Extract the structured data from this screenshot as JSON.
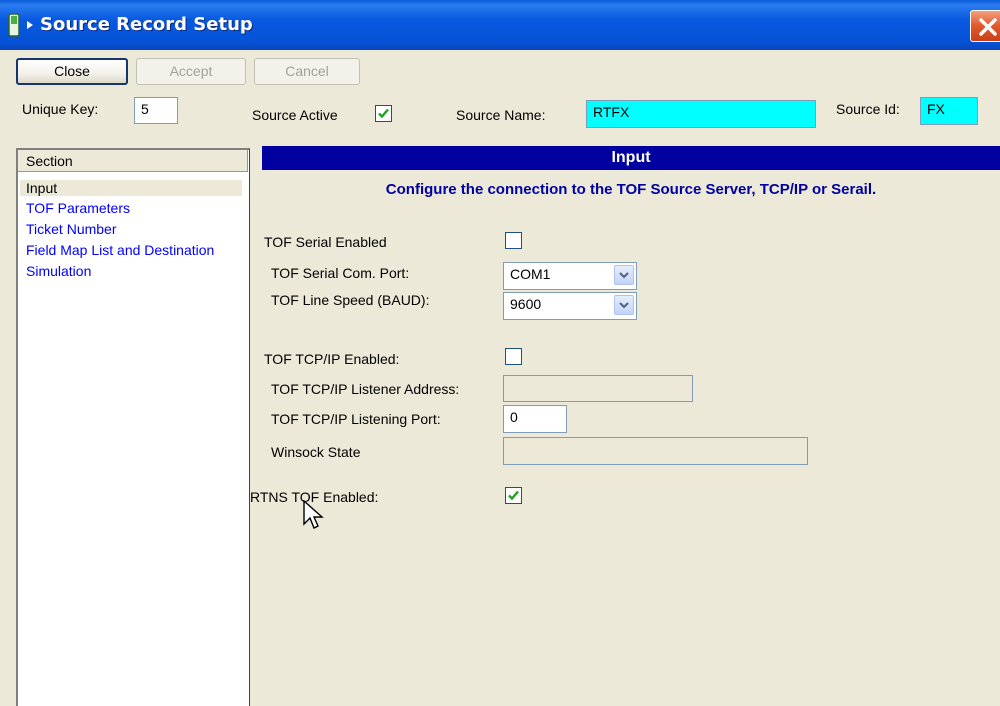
{
  "window": {
    "title": "Source Record Setup"
  },
  "toolbar": {
    "close_label": "Close",
    "accept_label": "Accept",
    "cancel_label": "Cancel"
  },
  "header": {
    "unique_key_label": "Unique Key:",
    "unique_key_value": "5",
    "source_active_label": "Source Active",
    "source_active_checked": true,
    "source_name_label": "Source Name:",
    "source_name_value": "RTFX",
    "source_id_label": "Source Id:",
    "source_id_value": "FX"
  },
  "sidebar": {
    "header": "Section",
    "items": [
      {
        "label": "Input",
        "selected": true
      },
      {
        "label": "TOF Parameters",
        "selected": false
      },
      {
        "label": "Ticket Number",
        "selected": false
      },
      {
        "label": "Field Map List and Destination",
        "selected": false
      },
      {
        "label": "Simulation",
        "selected": false
      }
    ]
  },
  "main": {
    "title": "Input",
    "subtitle": "Configure the connection to the TOF Source Server, TCP/IP or Serail.",
    "serial_enabled_label": "TOF Serial Enabled",
    "serial_enabled_checked": false,
    "serial_port_label": "TOF Serial Com. Port:",
    "serial_port_value": "COM1",
    "line_speed_label": "TOF Line Speed (BAUD):",
    "line_speed_value": "9600",
    "tcp_enabled_label": "TOF TCP/IP Enabled:",
    "tcp_enabled_checked": false,
    "tcp_address_label": "TOF TCP/IP Listener Address:",
    "tcp_address_value": "",
    "tcp_port_label": "TOF TCP/IP Listening Port:",
    "tcp_port_value": "0",
    "winsock_label": "Winsock State",
    "winsock_value": "",
    "rtns_label": "RTNS TOF Enabled:",
    "rtns_checked": true
  },
  "colors": {
    "title_bar": "#0552d6",
    "header_bar": "#0000a0",
    "highlight_field": "#00ffff",
    "link": "#0000ff"
  }
}
